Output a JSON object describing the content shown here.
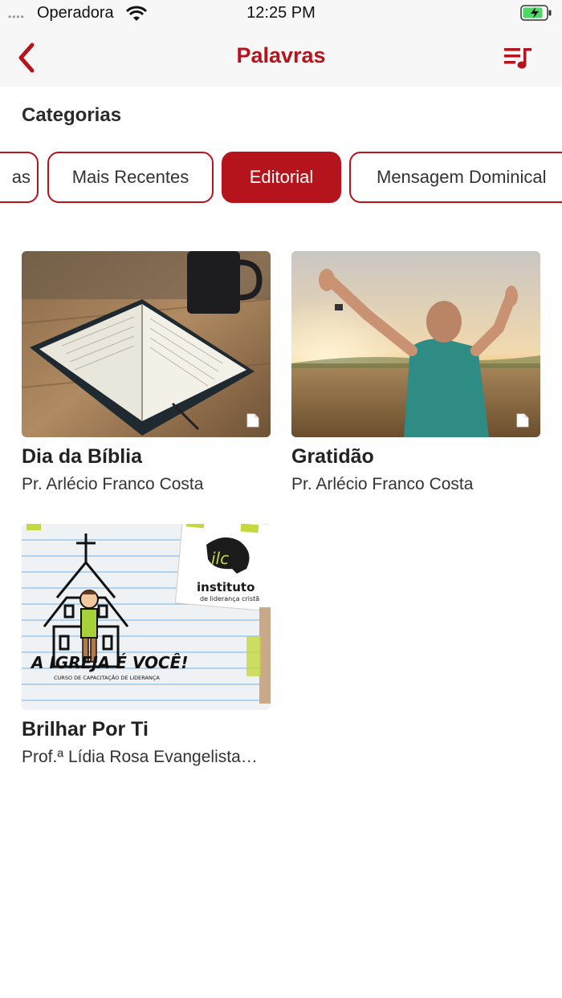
{
  "status_bar": {
    "signal": "••••",
    "carrier": "Operadora",
    "time": "12:25 PM"
  },
  "nav": {
    "title": "Palavras",
    "back_icon": "chevron-left-icon",
    "playlist_icon": "playlist-music-icon"
  },
  "categories": {
    "title": "Categorias",
    "chips": [
      {
        "label": "as"
      },
      {
        "label": "Mais Recentes"
      },
      {
        "label": "Editorial"
      },
      {
        "label": "Mensagem Dominical"
      }
    ],
    "active_index": 2
  },
  "colors": {
    "accent": "#b5141d"
  },
  "cards": [
    {
      "title": "Dia da Bíblia",
      "author": "Pr. Arlécio Franco Costa",
      "icon": "document-icon"
    },
    {
      "title": "Gratidão",
      "author": "Pr. Arlécio Franco Costa",
      "icon": "document-icon"
    },
    {
      "title": "Brilhar Por Ti",
      "author": "Prof.ª Lídia Rosa Evangelista…",
      "icon": "document-icon",
      "image_text": {
        "logo": "ilc",
        "brand": "instituto",
        "brand_sub": "de liderança cristã",
        "headline": "A IGREJA É VOCÊ!",
        "subline": "CURSO DE CAPACITAÇÃO DE LIDERANÇA"
      }
    }
  ]
}
